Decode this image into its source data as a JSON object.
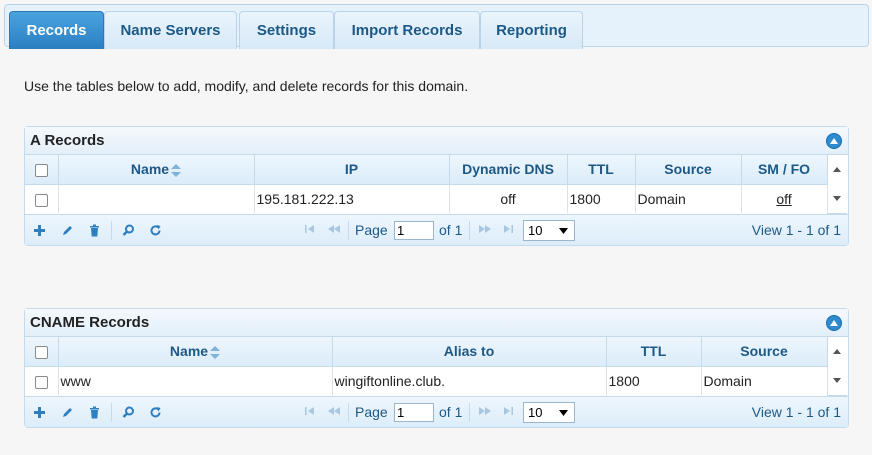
{
  "tabs": [
    {
      "label": "Records",
      "active": true
    },
    {
      "label": "Name Servers"
    },
    {
      "label": "Settings"
    },
    {
      "label": "Import Records"
    },
    {
      "label": "Reporting"
    }
  ],
  "intro": "Use the tables below to add, modify, and delete records for this domain.",
  "a_records": {
    "title": "A Records",
    "columns": [
      "Name",
      "IP",
      "Dynamic DNS",
      "TTL",
      "Source",
      "SM / FO"
    ],
    "rows": [
      {
        "name": "",
        "ip": "195.181.222.13",
        "dynamic_dns": "off",
        "ttl": "1800",
        "source": "Domain",
        "smfo": "off"
      }
    ],
    "pager": {
      "page_label": "Page",
      "page_value": "1",
      "of_label": "of 1",
      "rows_per_page": "10",
      "view_info": "View 1 - 1 of 1"
    }
  },
  "cname_records": {
    "title": "CNAME Records",
    "columns": [
      "Name",
      "Alias to",
      "TTL",
      "Source"
    ],
    "rows": [
      {
        "name": "www",
        "alias": "wingiftonline.club.",
        "ttl": "1800",
        "source": "Domain"
      }
    ],
    "pager": {
      "page_label": "Page",
      "page_value": "1",
      "of_label": "of 1",
      "rows_per_page": "10",
      "view_info": "View 1 - 1 of 1"
    }
  },
  "colors": {
    "accent": "#2a7fc2",
    "header_text": "#1d5987",
    "border": "#c5dbec"
  }
}
